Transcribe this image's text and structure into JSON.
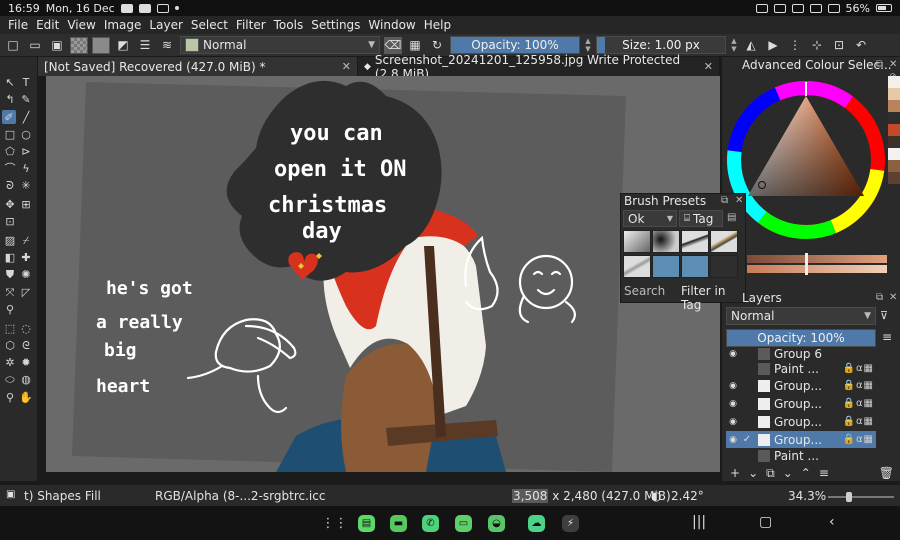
{
  "status_bar": {
    "time": "16:59",
    "date": "Mon, 16 Dec",
    "battery": "56%"
  },
  "menu": [
    "File",
    "Edit",
    "View",
    "Image",
    "Layer",
    "Select",
    "Filter",
    "Tools",
    "Settings",
    "Window",
    "Help"
  ],
  "toolbar": {
    "blend_mode": "Normal",
    "opacity_label": "Opacity: 100%",
    "opacity_value": 1.0,
    "size_label": "Size: 1.00 px"
  },
  "tabs": [
    {
      "label": "[Not Saved]  Recovered (427.0 MiB) *",
      "active": true
    },
    {
      "label": "Screenshot_20241201_125958.jpg Write Protected (2.8 MiB)",
      "active": false
    }
  ],
  "canvas": {
    "text_top": [
      "you can",
      "open it ON",
      "christmas",
      "day"
    ],
    "text_left": [
      "he's got",
      "a really",
      "big",
      "heart"
    ]
  },
  "dockers": {
    "colour_selector_title": "Advanced Colour Selec...",
    "brush_presets": {
      "title": "Brush Presets",
      "combo": "Ok",
      "tag": "Tag",
      "search_placeholder": "Search",
      "filter_in_tag": "Filter in Tag"
    },
    "layers": {
      "title": "Layers",
      "mode": "Normal",
      "opacity_label": "Opacity:  100%",
      "rows": [
        {
          "name": "Group 6",
          "kind": "group",
          "visible": true,
          "selected": false
        },
        {
          "name": "Paint ...",
          "kind": "paint",
          "visible": false,
          "selected": false
        },
        {
          "name": "Group...",
          "kind": "group",
          "visible": true,
          "selected": false
        },
        {
          "name": "Group...",
          "kind": "group",
          "visible": true,
          "selected": false
        },
        {
          "name": "Group...",
          "kind": "group",
          "visible": true,
          "selected": false
        },
        {
          "name": "Group...",
          "kind": "group",
          "visible": true,
          "selected": true
        },
        {
          "name": "Paint ...",
          "kind": "paint",
          "visible": false,
          "selected": false
        }
      ]
    }
  },
  "app_status": {
    "tool": "t) Shapes Fill",
    "color_profile": "RGB/Alpha (8-...2-srgbtrc.icc",
    "width": "3,508",
    "dimensions_rest": "x 2,480 (427.0 MiB)",
    "rotation": "2.42°",
    "zoom": "34.3%"
  },
  "colors": {
    "accent": "#4f79a8",
    "canvas_bg": "#6a6a6a",
    "paper": "#5c5c5c",
    "ink_black": "#2e2e2e",
    "scarf_red": "#d8321e",
    "skin": "#8b5a36",
    "shirt": "#f1eee8",
    "jeans": "#1f4e73",
    "swatches": [
      "#f4efe9",
      "#e7c9a8",
      "#b8845a",
      "#2d2d2d",
      "#c24a2a",
      "#3d3028",
      "#f2f2f2",
      "#8a6040",
      "#5c4030"
    ]
  }
}
